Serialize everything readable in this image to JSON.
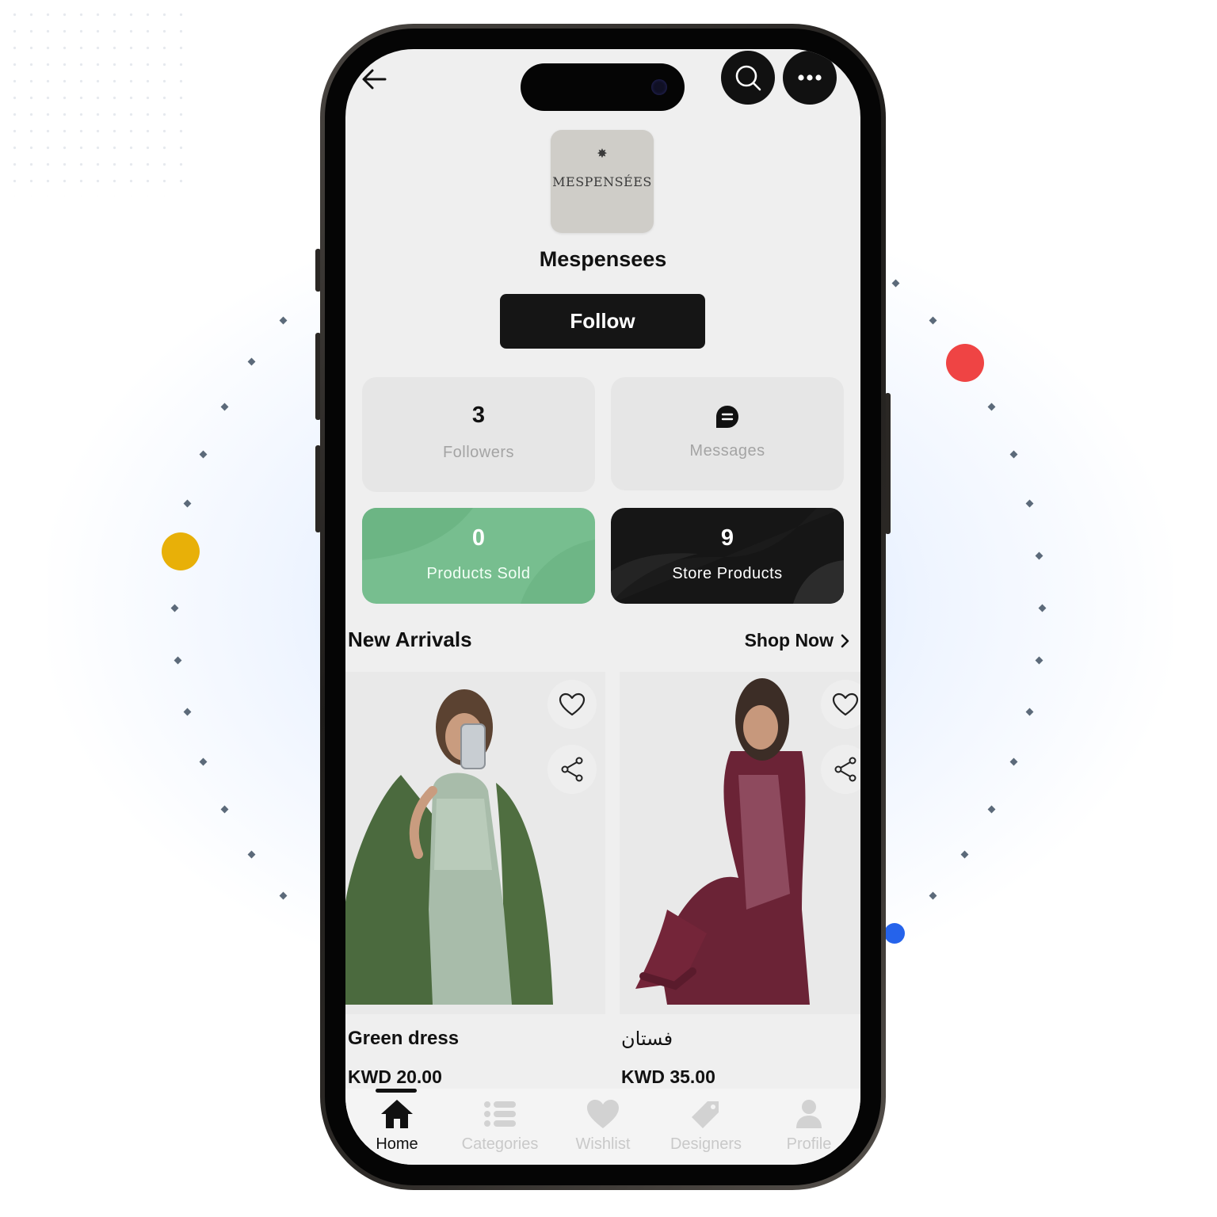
{
  "header": {
    "back_icon": "arrow-left-icon",
    "search_icon": "search-icon",
    "more_icon": "more-horizontal-icon"
  },
  "store": {
    "logo_text": "MESPENSÉES",
    "logo_mark": "✸",
    "name": "Mespensees",
    "follow_label": "Follow"
  },
  "stats": {
    "followers": {
      "value": "3",
      "label": "Followers"
    },
    "messages": {
      "icon": "chat-bubble-icon",
      "label": "Messages"
    },
    "products_sold": {
      "value": "0",
      "label": "Products Sold"
    },
    "store_products": {
      "value": "9",
      "label": "Store Products"
    }
  },
  "new_arrivals": {
    "title": "New Arrivals",
    "shop_now": "Shop Now"
  },
  "products": [
    {
      "name": "Green dress",
      "price": "KWD 20.00"
    },
    {
      "name": "فستان",
      "price": "KWD 35.00"
    }
  ],
  "tabs": [
    {
      "label": "Home",
      "icon": "home-icon",
      "active": true
    },
    {
      "label": "Categories",
      "icon": "list-icon",
      "active": false
    },
    {
      "label": "Wishlist",
      "icon": "heart-icon",
      "active": false
    },
    {
      "label": "Designers",
      "icon": "tag-icon",
      "active": false
    },
    {
      "label": "Profile",
      "icon": "user-icon",
      "active": false
    }
  ],
  "colors": {
    "accent_green": "#77be8f",
    "dark": "#161616",
    "red_dot": "#ef4444",
    "yellow_dot": "#e8b008",
    "blue_dot": "#2563eb"
  }
}
